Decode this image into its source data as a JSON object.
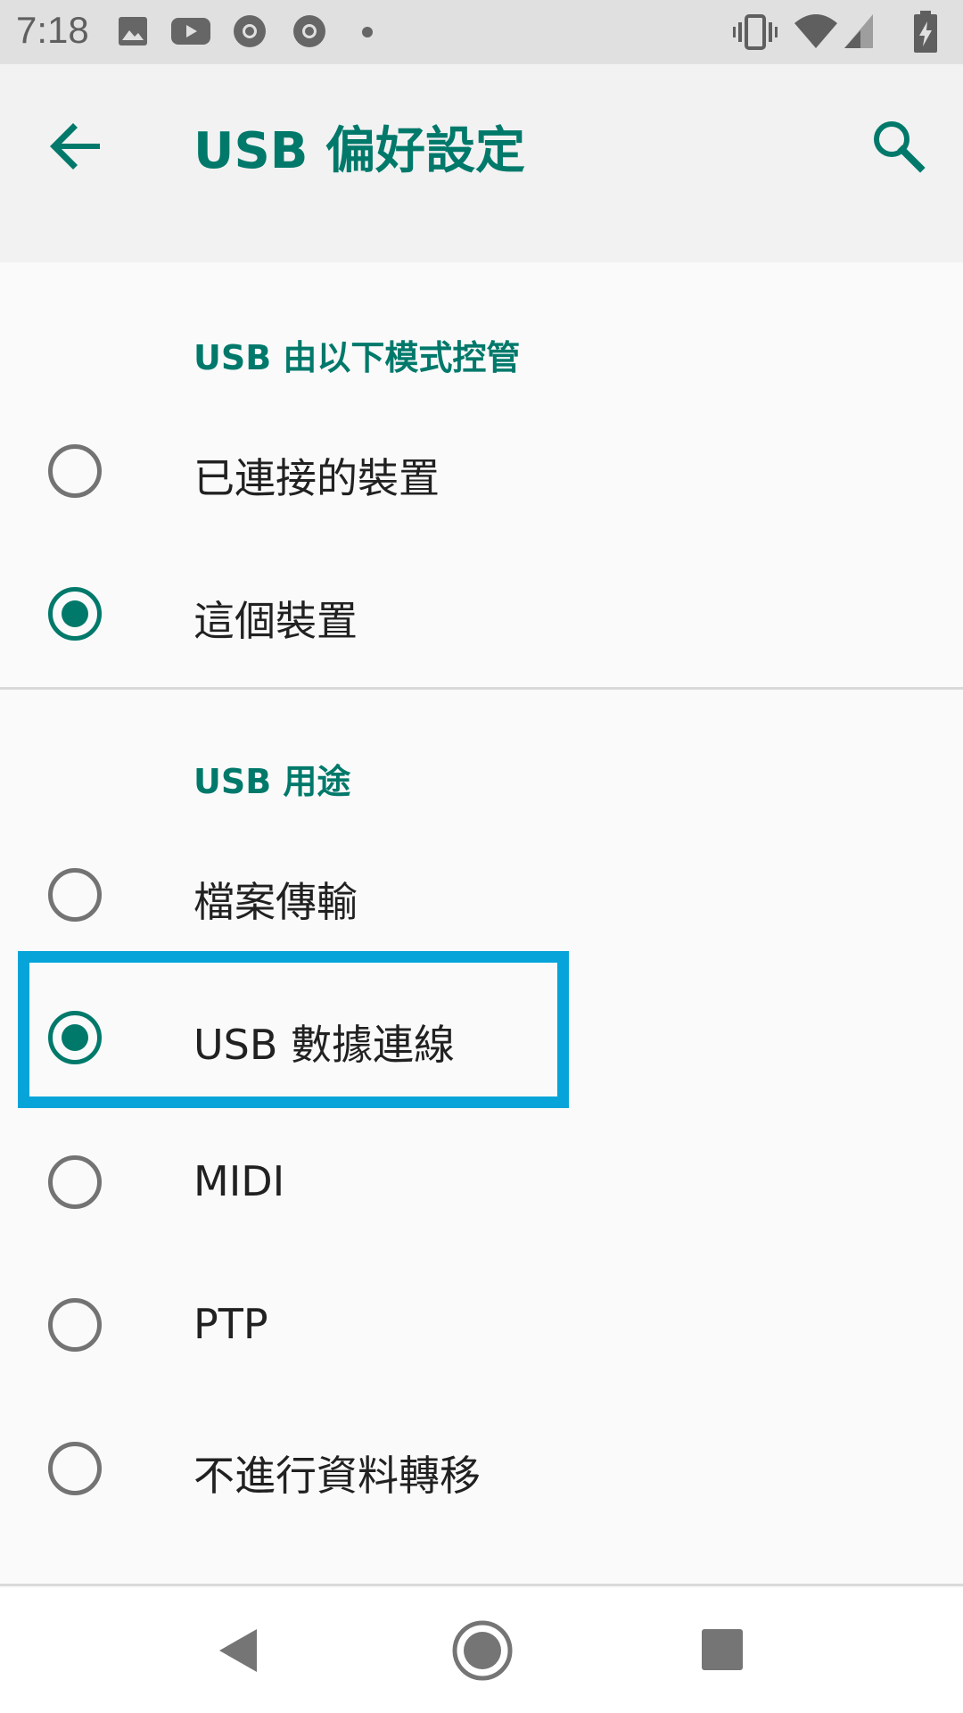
{
  "status_bar": {
    "time": "7:18",
    "icons_left": [
      "image-icon",
      "youtube-icon",
      "chrome-icon",
      "chrome-icon",
      "dot-icon"
    ],
    "icons_right": [
      "vibrate-icon",
      "wifi-icon",
      "cell-signal-icon",
      "battery-charging-icon"
    ]
  },
  "app_bar": {
    "title": "USB 偏好設定",
    "back_icon": "arrow-back-icon",
    "search_icon": "search-icon"
  },
  "sections": [
    {
      "title": "USB 由以下模式控管",
      "options": [
        {
          "label": "已連接的裝置",
          "checked": false
        },
        {
          "label": "這個裝置",
          "checked": true
        }
      ]
    },
    {
      "title": "USB 用途",
      "options": [
        {
          "label": "檔案傳輸",
          "checked": false
        },
        {
          "label": "USB 數據連線",
          "checked": true
        },
        {
          "label": "MIDI",
          "checked": false
        },
        {
          "label": "PTP",
          "checked": false
        },
        {
          "label": "不進行資料轉移",
          "checked": false
        }
      ]
    }
  ],
  "nav_bar": {
    "buttons": [
      "back-triangle-icon",
      "home-circle-icon",
      "recents-square-icon"
    ]
  },
  "colors": {
    "accent": "#00796b",
    "highlight": "#06a4d9",
    "status_bar": "#e0e0e0",
    "app_bar": "#f2f2f2",
    "background": "#fafafa"
  }
}
